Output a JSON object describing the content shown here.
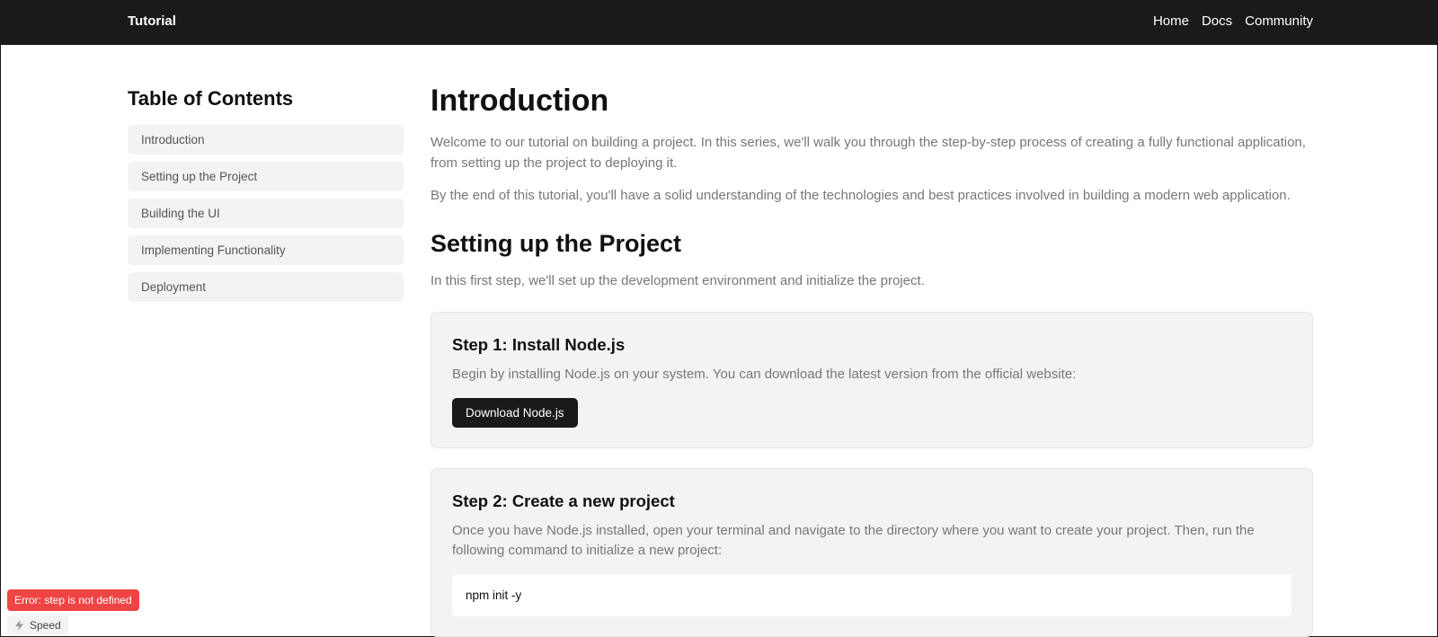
{
  "header": {
    "brand": "Tutorial",
    "nav": [
      "Home",
      "Docs",
      "Community"
    ]
  },
  "toc": {
    "title": "Table of Contents",
    "items": [
      "Introduction",
      "Setting up the Project",
      "Building the UI",
      "Implementing Functionality",
      "Deployment"
    ]
  },
  "intro": {
    "title": "Introduction",
    "paragraphs": [
      "Welcome to our tutorial on building a project. In this series, we'll walk you through the step-by-step process of creating a fully functional application, from setting up the project to deploying it.",
      "By the end of this tutorial, you'll have a solid understanding of the technologies and best practices involved in building a modern web application."
    ]
  },
  "setup": {
    "title": "Setting up the Project",
    "description": "In this first step, we'll set up the development environment and initialize the project."
  },
  "steps": [
    {
      "title": "Step 1: Install Node.js",
      "text": "Begin by installing Node.js on your system. You can download the latest version from the official website:",
      "button": "Download Node.js"
    },
    {
      "title": "Step 2: Create a new project",
      "text": "Once you have Node.js installed, open your terminal and navigate to the directory where you want to create your project. Then, run the following command to initialize a new project:",
      "code": "npm init -y"
    }
  ],
  "overlay": {
    "error": "Error: step is not defined",
    "speed_label": "Speed",
    "speed_icon": "lightning-icon"
  },
  "colors": {
    "header_bg": "#1a1a1a",
    "error_bg": "#ef4444",
    "card_bg": "#f3f3f3"
  }
}
